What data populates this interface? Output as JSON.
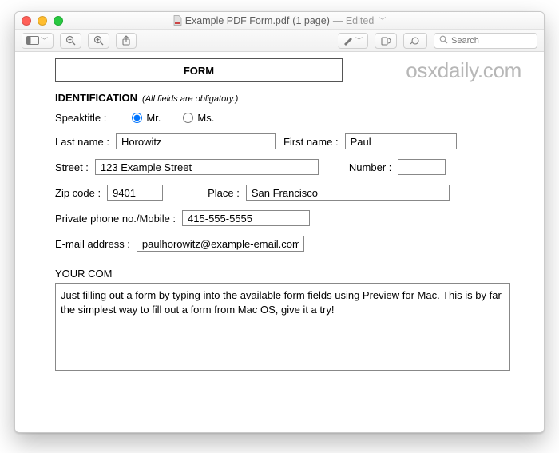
{
  "title": {
    "filename": "Example PDF Form.pdf",
    "pages": "(1 page)",
    "status": "— Edited"
  },
  "toolbar": {
    "search_placeholder": "Search"
  },
  "watermark": "osxdaily.com",
  "form": {
    "header": "FORM",
    "section_label": "IDENTIFICATION",
    "section_note": "(All fields are obligatory.)",
    "speaktitle_label": "Speaktitle :",
    "radio_mr": "Mr.",
    "radio_ms": "Ms.",
    "lastname_label": "Last name :",
    "lastname_value": "Horowitz",
    "firstname_label": "First name :",
    "firstname_value": "Paul",
    "street_label": "Street :",
    "street_value": "123 Example Street",
    "number_label": "Number :",
    "number_value": "",
    "zip_label": "Zip code :",
    "zip_value": "9401",
    "place_label": "Place :",
    "place_value": "San Francisco",
    "phone_label": "Private phone no./Mobile :",
    "phone_value": "415-555-5555",
    "email_label": "E-mail address :",
    "email_value": "paulhorowitz@example-email.com",
    "your_com_label": "YOUR COM",
    "comments_value": "Just filling out a form by typing into the available form fields using Preview for Mac. This is by far the simplest way to fill out a form from Mac OS, give it a try!"
  }
}
